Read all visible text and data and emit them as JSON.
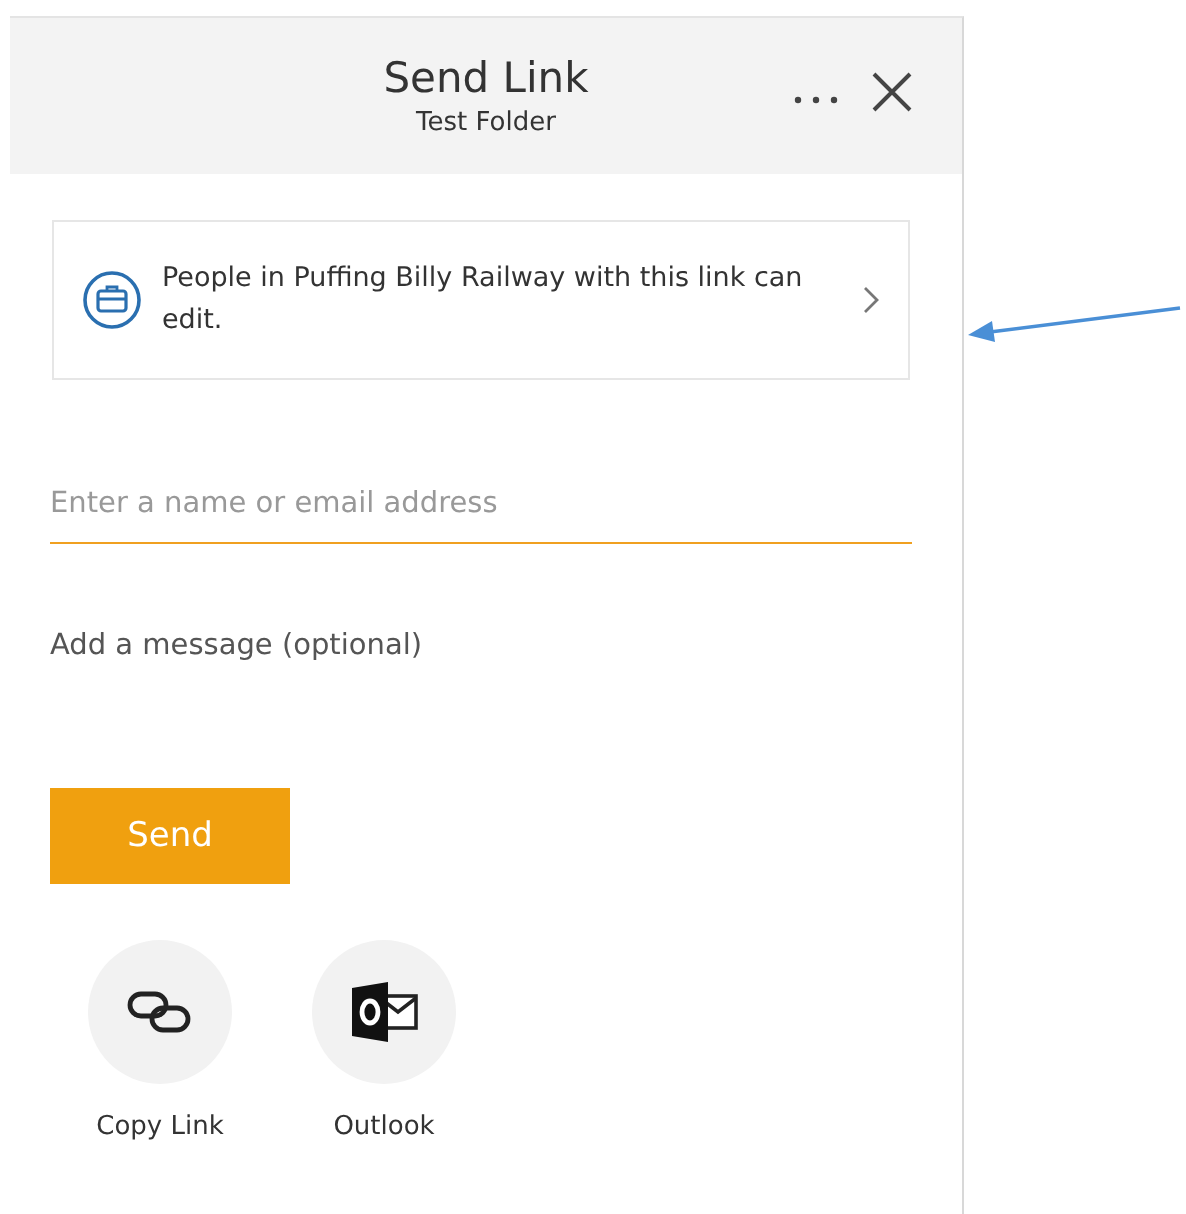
{
  "header": {
    "title": "Send Link",
    "subtitle": "Test Folder"
  },
  "permission": {
    "text": "People in Puffing Billy Railway with this link can edit."
  },
  "recipient": {
    "placeholder": "Enter a name or email address"
  },
  "message": {
    "placeholder": "Add a message (optional)"
  },
  "send_button": "Send",
  "share_options": [
    {
      "kind": "copy-link",
      "label": "Copy Link"
    },
    {
      "kind": "outlook",
      "label": "Outlook"
    }
  ]
}
